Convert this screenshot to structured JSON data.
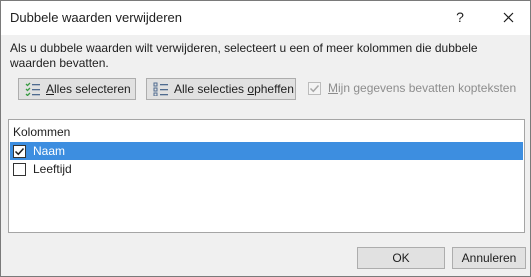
{
  "dialog": {
    "title": "Dubbele waarden verwijderen",
    "help_label": "?",
    "description": "Als u dubbele waarden wilt verwijderen, selecteert u een of meer kolommen die dubbele waarden bevatten."
  },
  "buttons": {
    "select_all_a": "A",
    "select_all_b": "lles selecteren",
    "clear_a": "Alle selecties ",
    "clear_b": "o",
    "clear_c": "pheffen",
    "ok": "OK",
    "cancel": "Annuleren"
  },
  "headers_checkbox": {
    "label_a": "M",
    "label_b": "ijn gegevens bevatten kopteksten",
    "checked": true,
    "enabled": false
  },
  "columns": {
    "header": "Kolommen",
    "items": [
      {
        "label": "Naam",
        "checked": true,
        "selected": true
      },
      {
        "label": "Leeftijd",
        "checked": false,
        "selected": false
      }
    ]
  },
  "colors": {
    "selection": "#3d8ee0",
    "accent_icon": "#3a9b43",
    "list_icon": "#4f6b8f"
  },
  "icons": [
    "select-all-icon",
    "clear-selection-icon",
    "help-icon",
    "close-icon",
    "checkmark-icon"
  ]
}
